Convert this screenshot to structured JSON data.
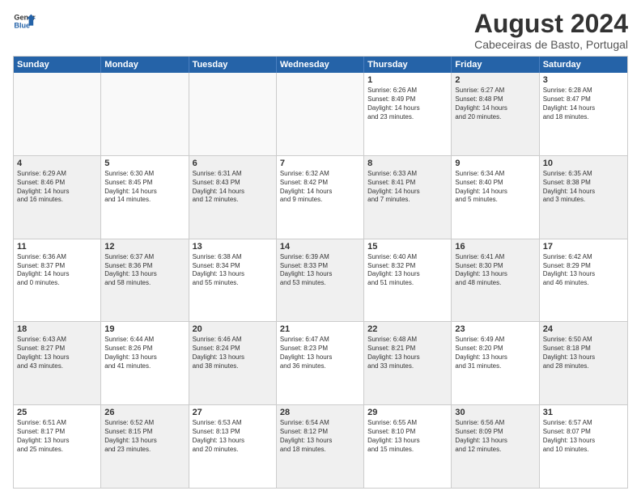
{
  "header": {
    "logo_general": "General",
    "logo_blue": "Blue",
    "month": "August 2024",
    "location": "Cabeceiras de Basto, Portugal"
  },
  "days_of_week": [
    "Sunday",
    "Monday",
    "Tuesday",
    "Wednesday",
    "Thursday",
    "Friday",
    "Saturday"
  ],
  "rows": [
    [
      {
        "day": "",
        "empty": true
      },
      {
        "day": "",
        "empty": true
      },
      {
        "day": "",
        "empty": true
      },
      {
        "day": "",
        "empty": true
      },
      {
        "day": "1",
        "lines": [
          "Sunrise: 6:26 AM",
          "Sunset: 8:49 PM",
          "Daylight: 14 hours",
          "and 23 minutes."
        ],
        "shaded": false
      },
      {
        "day": "2",
        "lines": [
          "Sunrise: 6:27 AM",
          "Sunset: 8:48 PM",
          "Daylight: 14 hours",
          "and 20 minutes."
        ],
        "shaded": true
      },
      {
        "day": "3",
        "lines": [
          "Sunrise: 6:28 AM",
          "Sunset: 8:47 PM",
          "Daylight: 14 hours",
          "and 18 minutes."
        ],
        "shaded": false
      }
    ],
    [
      {
        "day": "4",
        "lines": [
          "Sunrise: 6:29 AM",
          "Sunset: 8:46 PM",
          "Daylight: 14 hours",
          "and 16 minutes."
        ],
        "shaded": true
      },
      {
        "day": "5",
        "lines": [
          "Sunrise: 6:30 AM",
          "Sunset: 8:45 PM",
          "Daylight: 14 hours",
          "and 14 minutes."
        ],
        "shaded": false
      },
      {
        "day": "6",
        "lines": [
          "Sunrise: 6:31 AM",
          "Sunset: 8:43 PM",
          "Daylight: 14 hours",
          "and 12 minutes."
        ],
        "shaded": true
      },
      {
        "day": "7",
        "lines": [
          "Sunrise: 6:32 AM",
          "Sunset: 8:42 PM",
          "Daylight: 14 hours",
          "and 9 minutes."
        ],
        "shaded": false
      },
      {
        "day": "8",
        "lines": [
          "Sunrise: 6:33 AM",
          "Sunset: 8:41 PM",
          "Daylight: 14 hours",
          "and 7 minutes."
        ],
        "shaded": true
      },
      {
        "day": "9",
        "lines": [
          "Sunrise: 6:34 AM",
          "Sunset: 8:40 PM",
          "Daylight: 14 hours",
          "and 5 minutes."
        ],
        "shaded": false
      },
      {
        "day": "10",
        "lines": [
          "Sunrise: 6:35 AM",
          "Sunset: 8:38 PM",
          "Daylight: 14 hours",
          "and 3 minutes."
        ],
        "shaded": true
      }
    ],
    [
      {
        "day": "11",
        "lines": [
          "Sunrise: 6:36 AM",
          "Sunset: 8:37 PM",
          "Daylight: 14 hours",
          "and 0 minutes."
        ],
        "shaded": false
      },
      {
        "day": "12",
        "lines": [
          "Sunrise: 6:37 AM",
          "Sunset: 8:36 PM",
          "Daylight: 13 hours",
          "and 58 minutes."
        ],
        "shaded": true
      },
      {
        "day": "13",
        "lines": [
          "Sunrise: 6:38 AM",
          "Sunset: 8:34 PM",
          "Daylight: 13 hours",
          "and 55 minutes."
        ],
        "shaded": false
      },
      {
        "day": "14",
        "lines": [
          "Sunrise: 6:39 AM",
          "Sunset: 8:33 PM",
          "Daylight: 13 hours",
          "and 53 minutes."
        ],
        "shaded": true
      },
      {
        "day": "15",
        "lines": [
          "Sunrise: 6:40 AM",
          "Sunset: 8:32 PM",
          "Daylight: 13 hours",
          "and 51 minutes."
        ],
        "shaded": false
      },
      {
        "day": "16",
        "lines": [
          "Sunrise: 6:41 AM",
          "Sunset: 8:30 PM",
          "Daylight: 13 hours",
          "and 48 minutes."
        ],
        "shaded": true
      },
      {
        "day": "17",
        "lines": [
          "Sunrise: 6:42 AM",
          "Sunset: 8:29 PM",
          "Daylight: 13 hours",
          "and 46 minutes."
        ],
        "shaded": false
      }
    ],
    [
      {
        "day": "18",
        "lines": [
          "Sunrise: 6:43 AM",
          "Sunset: 8:27 PM",
          "Daylight: 13 hours",
          "and 43 minutes."
        ],
        "shaded": true
      },
      {
        "day": "19",
        "lines": [
          "Sunrise: 6:44 AM",
          "Sunset: 8:26 PM",
          "Daylight: 13 hours",
          "and 41 minutes."
        ],
        "shaded": false
      },
      {
        "day": "20",
        "lines": [
          "Sunrise: 6:46 AM",
          "Sunset: 8:24 PM",
          "Daylight: 13 hours",
          "and 38 minutes."
        ],
        "shaded": true
      },
      {
        "day": "21",
        "lines": [
          "Sunrise: 6:47 AM",
          "Sunset: 8:23 PM",
          "Daylight: 13 hours",
          "and 36 minutes."
        ],
        "shaded": false
      },
      {
        "day": "22",
        "lines": [
          "Sunrise: 6:48 AM",
          "Sunset: 8:21 PM",
          "Daylight: 13 hours",
          "and 33 minutes."
        ],
        "shaded": true
      },
      {
        "day": "23",
        "lines": [
          "Sunrise: 6:49 AM",
          "Sunset: 8:20 PM",
          "Daylight: 13 hours",
          "and 31 minutes."
        ],
        "shaded": false
      },
      {
        "day": "24",
        "lines": [
          "Sunrise: 6:50 AM",
          "Sunset: 8:18 PM",
          "Daylight: 13 hours",
          "and 28 minutes."
        ],
        "shaded": true
      }
    ],
    [
      {
        "day": "25",
        "lines": [
          "Sunrise: 6:51 AM",
          "Sunset: 8:17 PM",
          "Daylight: 13 hours",
          "and 25 minutes."
        ],
        "shaded": false
      },
      {
        "day": "26",
        "lines": [
          "Sunrise: 6:52 AM",
          "Sunset: 8:15 PM",
          "Daylight: 13 hours",
          "and 23 minutes."
        ],
        "shaded": true
      },
      {
        "day": "27",
        "lines": [
          "Sunrise: 6:53 AM",
          "Sunset: 8:13 PM",
          "Daylight: 13 hours",
          "and 20 minutes."
        ],
        "shaded": false
      },
      {
        "day": "28",
        "lines": [
          "Sunrise: 6:54 AM",
          "Sunset: 8:12 PM",
          "Daylight: 13 hours",
          "and 18 minutes."
        ],
        "shaded": true
      },
      {
        "day": "29",
        "lines": [
          "Sunrise: 6:55 AM",
          "Sunset: 8:10 PM",
          "Daylight: 13 hours",
          "and 15 minutes."
        ],
        "shaded": false
      },
      {
        "day": "30",
        "lines": [
          "Sunrise: 6:56 AM",
          "Sunset: 8:09 PM",
          "Daylight: 13 hours",
          "and 12 minutes."
        ],
        "shaded": true
      },
      {
        "day": "31",
        "lines": [
          "Sunrise: 6:57 AM",
          "Sunset: 8:07 PM",
          "Daylight: 13 hours",
          "and 10 minutes."
        ],
        "shaded": false
      }
    ]
  ]
}
